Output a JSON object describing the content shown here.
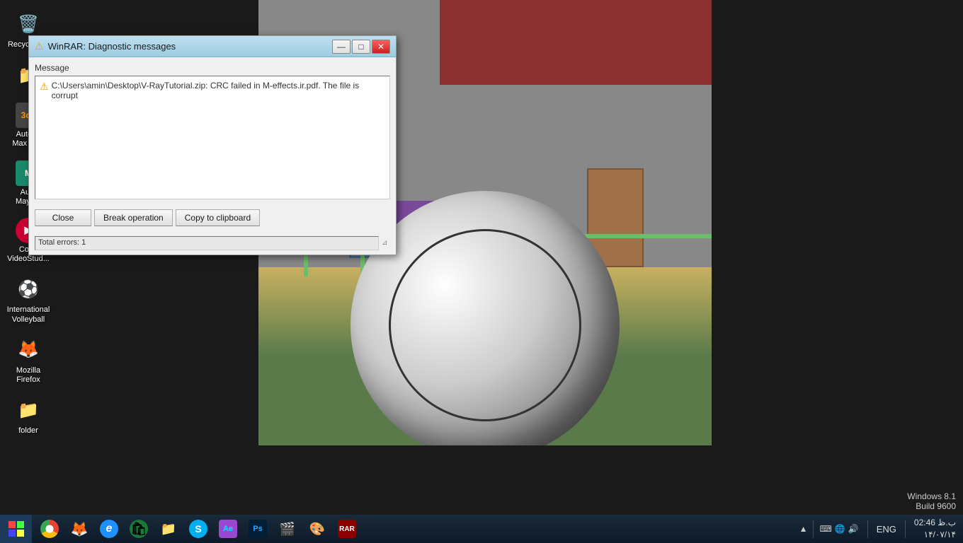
{
  "desktop": {
    "bg_color": "#1a1a1a"
  },
  "icons": [
    {
      "id": "recycle-bin",
      "label": "Recycle Bin",
      "symbol": "🗑"
    },
    {
      "id": "folder-yellow",
      "label": "",
      "symbol": "📁"
    },
    {
      "id": "autodesk-max",
      "label": "Autode Max 20...",
      "symbol": "🅰"
    },
    {
      "id": "autodesk-maya",
      "label": "Auto Maya...",
      "symbol": "🅰"
    },
    {
      "id": "corel-video",
      "label": "Corel VideoStud...",
      "symbol": "▶"
    },
    {
      "id": "intl-volleyball",
      "label": "International Volleyball",
      "symbol": "⚽"
    },
    {
      "id": "mozilla-firefox",
      "label": "Mozilla Firefox",
      "symbol": "🦊"
    },
    {
      "id": "folder2",
      "label": "folder",
      "symbol": "📁"
    }
  ],
  "dialog": {
    "title": "WinRAR: Diagnostic messages",
    "title_icon": "⚠",
    "column_header": "Message",
    "message_icon": "⚠",
    "message_text": "C:\\Users\\amin\\Desktop\\V-RayTutorial.zip: CRC failed in M-effects.ir.pdf. The file is corrupt",
    "status_text": "Total errors: 1",
    "buttons": {
      "close": "Close",
      "break_operation": "Break operation",
      "copy_clipboard": "Copy to clipboard"
    },
    "window_controls": {
      "minimize": "—",
      "restore": "□",
      "close": "✕"
    }
  },
  "taskbar": {
    "start_label": "⊞",
    "icons": [
      {
        "id": "chrome",
        "symbol": "🌐",
        "label": "Chrome"
      },
      {
        "id": "firefox",
        "symbol": "🦊",
        "label": "Firefox"
      },
      {
        "id": "ie",
        "symbol": "e",
        "label": "Internet Explorer"
      },
      {
        "id": "store",
        "symbol": "🛍",
        "label": "Windows Store"
      },
      {
        "id": "explorer",
        "symbol": "📁",
        "label": "File Explorer"
      },
      {
        "id": "skype",
        "symbol": "S",
        "label": "Skype"
      },
      {
        "id": "ae",
        "symbol": "Ae",
        "label": "After Effects"
      },
      {
        "id": "ps",
        "symbol": "Ps",
        "label": "Photoshop"
      },
      {
        "id": "studio",
        "symbol": "🎬",
        "label": "Studio"
      },
      {
        "id": "something",
        "symbol": "🎨",
        "label": "Paint"
      },
      {
        "id": "winrar",
        "symbol": "W",
        "label": "WinRAR"
      }
    ],
    "tray": {
      "expand": "▲",
      "lang": "ENG",
      "network": "🌐",
      "volume": "🔊"
    },
    "time": "02:46 ب.ظ",
    "date": "۱۴/۰۷/۱۴",
    "windows_version": "Windows 8.1",
    "build": "Build 9600"
  }
}
